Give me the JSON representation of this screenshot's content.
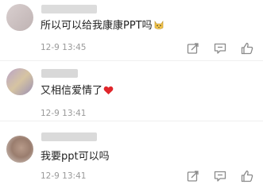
{
  "comments": [
    {
      "text": "所以可以给我康康PPT吗",
      "emoji": "cat-face",
      "time": "12-9 13:45"
    },
    {
      "text": "又相信爱情了",
      "emoji": "red-heart",
      "time": "12-9 13:41"
    },
    {
      "text": "我要ppt可以吗",
      "time": "12-9 13:41"
    }
  ],
  "colors": {
    "meta_text": "#9a9a9a",
    "icon": "#8a8a8a",
    "body_text": "#222222",
    "heart": "#e0262b"
  },
  "icons": [
    "share-icon",
    "reply-icon",
    "like-icon"
  ]
}
